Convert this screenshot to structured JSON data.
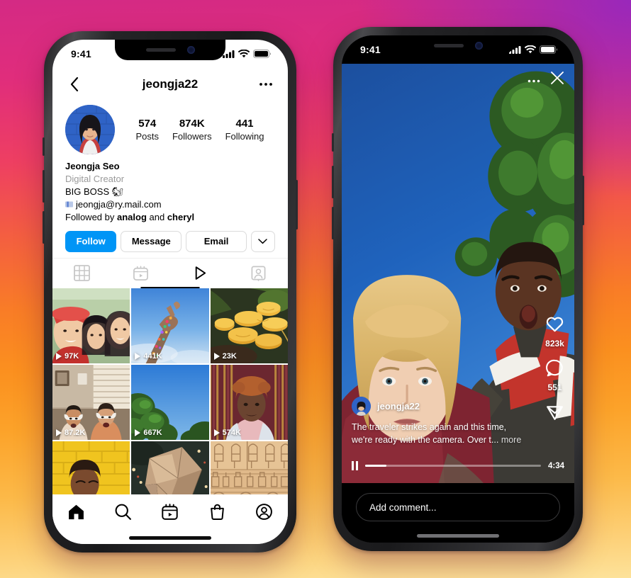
{
  "background": {
    "colors": [
      "#a830c0",
      "#d42a84",
      "#ee3f62",
      "#f97d26",
      "#fcb948",
      "#fde29a"
    ]
  },
  "accent": {
    "instagram_blue": "#0095F6",
    "border": "#dbdbdb",
    "muted_text": "#9a9a9a"
  },
  "left_phone": {
    "status": {
      "time": "9:41",
      "signal": "signal-icon",
      "wifi": "wifi-icon",
      "battery": "battery-icon"
    },
    "header": {
      "back": "back-icon",
      "title": "jeongja22",
      "menu": "more-options-icon"
    },
    "stats": [
      {
        "num": "574",
        "label": "Posts"
      },
      {
        "num": "874K",
        "label": "Followers"
      },
      {
        "num": "441",
        "label": "Following"
      }
    ],
    "bio": {
      "display_name": "Jeongja Seo",
      "category": "Digital Creator",
      "line1": "BIG BOSS 🐿",
      "email": "jeongja@ry.mail.com",
      "followed_prefix": "Followed by ",
      "followed_a": "analog",
      "followed_mid": " and ",
      "followed_b": "cheryl"
    },
    "actions": {
      "follow": "Follow",
      "message": "Message",
      "email": "Email",
      "caret": "chevron-down-icon"
    },
    "tabs": [
      {
        "name": "grid",
        "icon": "grid-icon",
        "active": false
      },
      {
        "name": "reels",
        "icon": "reels-icon",
        "active": false
      },
      {
        "name": "igtv",
        "icon": "play-triangle-icon",
        "active": true
      },
      {
        "name": "tagged",
        "icon": "tagged-person-icon",
        "active": false
      }
    ],
    "grid": [
      {
        "views": "97K",
        "desc": "three friends selfie, red bucket hat"
      },
      {
        "views": "441K",
        "desc": "hand with rainbow glitter against blue sky"
      },
      {
        "views": "23K",
        "desc": "yellow mushrooms on log"
      },
      {
        "views": "87.2K",
        "desc": "two people with headphones in living room"
      },
      {
        "views": "667K",
        "desc": "green tree against blue sky"
      },
      {
        "views": "574K",
        "desc": "person with red hair, gold tinsel backdrop"
      },
      {
        "views": "",
        "desc": "person laughing at yellow brick wall"
      },
      {
        "views": "",
        "desc": "crumpled paper texture on dark ground"
      },
      {
        "views": "",
        "desc": "carved stone hieroglyphics"
      }
    ],
    "tabbar": [
      {
        "name": "home",
        "icon": "home-icon",
        "active": true
      },
      {
        "name": "search",
        "icon": "search-icon",
        "active": false
      },
      {
        "name": "reels",
        "icon": "reels-icon",
        "active": false
      },
      {
        "name": "shop",
        "icon": "shop-bag-icon",
        "active": false
      },
      {
        "name": "profile",
        "icon": "profile-icon",
        "active": false
      }
    ]
  },
  "right_phone": {
    "status": {
      "time": "9:41",
      "signal": "signal-icon",
      "wifi": "wifi-icon",
      "battery": "battery-icon"
    },
    "video_top": {
      "menu": "more-options-icon",
      "close": "close-icon"
    },
    "side_actions": {
      "like_icon": "heart-icon",
      "like_count": "823k",
      "comment_icon": "comment-bubble-icon",
      "comment_count": "551",
      "share_icon": "share-paper-plane-icon"
    },
    "reel": {
      "username": "jeongja22",
      "caption": "The traveler strikes again and this time, we're ready with the camera. Over t...",
      "more_label": "more",
      "pause_icon": "pause-icon",
      "progress_percent": 12,
      "duration": "4:34"
    },
    "comment_bar": {
      "placeholder": "Add comment..."
    }
  }
}
